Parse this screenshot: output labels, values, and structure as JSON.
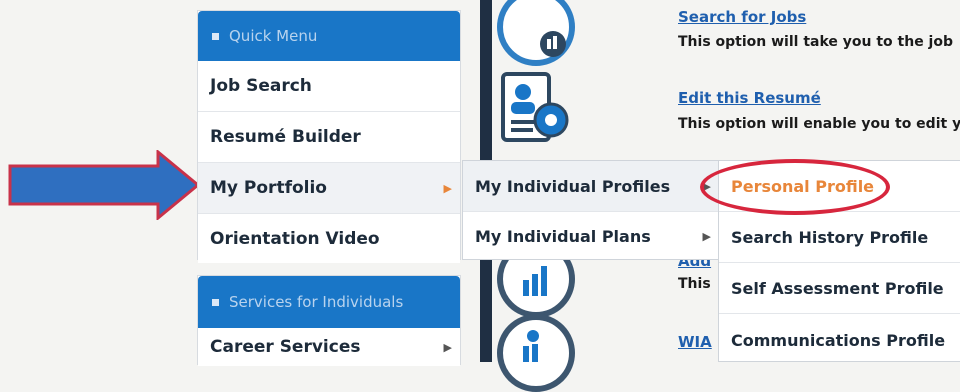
{
  "quick_menu": {
    "header": "Quick Menu",
    "items": [
      {
        "label": "Job Search"
      },
      {
        "label": "Resumé Builder"
      },
      {
        "label": "My Portfolio"
      },
      {
        "label": "Orientation Video"
      }
    ]
  },
  "services_menu": {
    "header": "Services for Individuals",
    "items": [
      {
        "label": "Career Services"
      }
    ]
  },
  "portfolio_submenu": {
    "items": [
      {
        "label": "My Individual Profiles"
      },
      {
        "label": "My Individual Plans"
      }
    ]
  },
  "profiles_submenu": {
    "items": [
      {
        "label": "Personal Profile"
      },
      {
        "label": "Search History Profile"
      },
      {
        "label": "Self Assessment Profile"
      },
      {
        "label": "Communications Profile"
      }
    ]
  },
  "content": {
    "search_jobs": {
      "title": "Search for Jobs",
      "desc": "This option will take you to the job"
    },
    "edit_resume": {
      "title": "Edit this Resumé",
      "desc": "This option will enable you to edit y"
    },
    "partial_1": {
      "title": "Add",
      "desc": "This"
    },
    "partial_2": {
      "title": "WIA"
    }
  },
  "colors": {
    "header_blue": "#1976c7",
    "highlight_orange": "#e8863a",
    "annotation_red": "#d7263d",
    "arrow_blue": "#2f6fc0"
  }
}
